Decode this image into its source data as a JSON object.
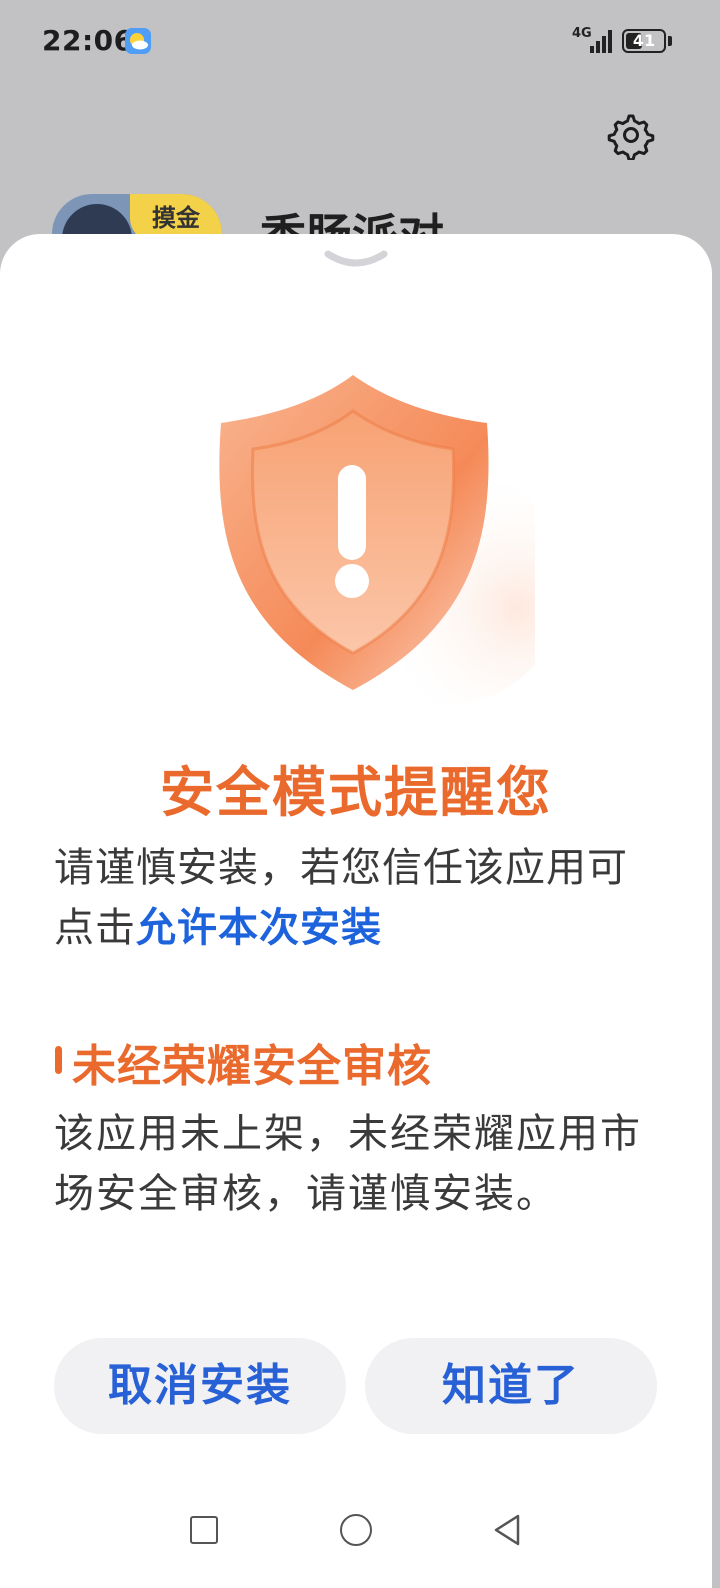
{
  "status_bar": {
    "time": "22:06",
    "network": "4G",
    "battery": "41",
    "battery_level": 0.41,
    "weather_icon": "partly-sunny-icon",
    "signal_icon": "signal-bars-icon"
  },
  "background_app": {
    "name": "香肠派对",
    "icon_badge": "摸金",
    "settings_icon": "gear-icon"
  },
  "sheet": {
    "handle_icon": "chevron-down-icon",
    "illustration_icon": "shield-warning-icon",
    "title": "安全模式提醒您",
    "description": "请谨慎安装，若您信任该应用可点击",
    "description_link": "允许本次安装",
    "section_title": "未经荣耀安全审核",
    "section_body": "该应用未上架，未经荣耀应用市场安全审核，请谨慎安装。"
  },
  "buttons": {
    "cancel": "取消安装",
    "ok": "知道了"
  },
  "nav": {
    "recents_icon": "square-recents-icon",
    "home_icon": "circle-home-icon",
    "back_icon": "triangle-back-icon"
  },
  "colors": {
    "accent_orange": "#ea6a2e",
    "link_blue": "#1d63dc",
    "button_text_blue": "#2860d6",
    "button_bg": "#f1f1f3"
  }
}
